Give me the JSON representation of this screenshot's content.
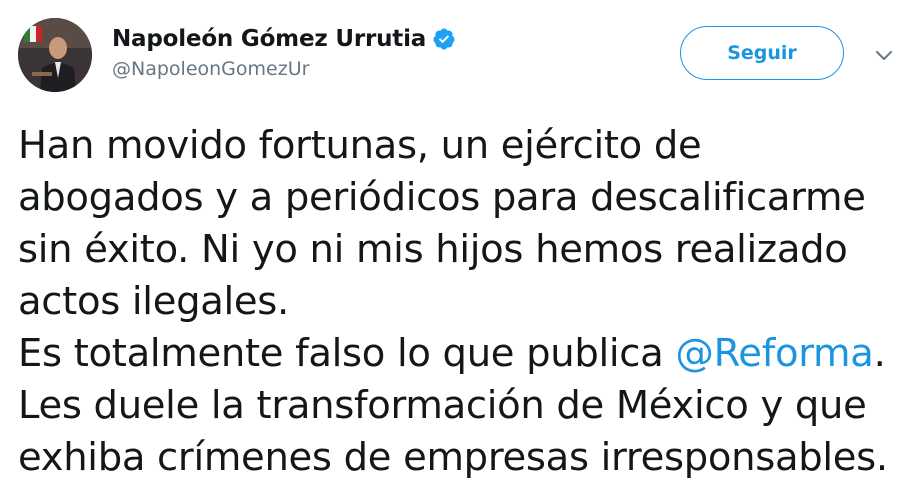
{
  "author": {
    "display_name": "Napoleón Gómez Urrutia",
    "handle": "@NapoleonGomezUr",
    "verified_icon": "verified-badge-icon",
    "avatar_icon": "profile-photo"
  },
  "actions": {
    "follow_label": "Seguir",
    "more_icon": "chevron-down-icon"
  },
  "tweet": {
    "lines": [
      {
        "text": "Han movido fortunas, un ejército de"
      },
      {
        "text": "abogados y a periódicos para descalificarme"
      },
      {
        "text": "sin éxito. Ni yo ni mis hijos hemos realizado"
      },
      {
        "text": "actos ilegales."
      },
      {
        "before": "Es totalmente falso lo que publica ",
        "mention": "@Reforma",
        "after": "."
      },
      {
        "text": "Les duele la transformación de México y que"
      },
      {
        "text": "exhiba crímenes de empresas irresponsables."
      }
    ]
  },
  "colors": {
    "link": "#1b95e0",
    "text": "#14171a",
    "secondary": "#657786"
  }
}
